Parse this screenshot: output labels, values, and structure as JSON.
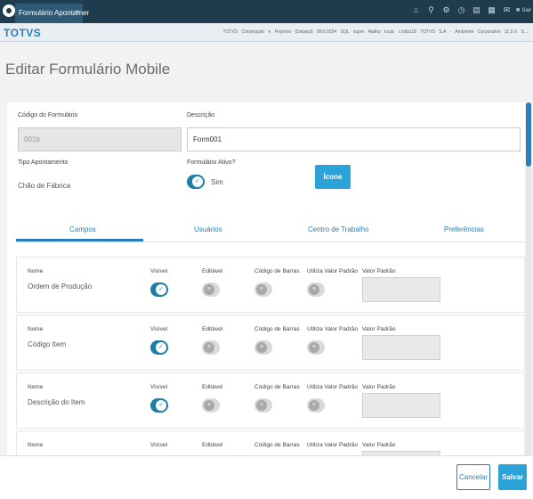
{
  "topbar": {
    "tab_label": "Formulário Apontamer",
    "tab_close": "×",
    "icons": [
      "home-icon",
      "network-icon",
      "gear-icon",
      "clock-icon",
      "print-icon",
      "grid-icon",
      "mail-icon"
    ],
    "sair": "Sair"
  },
  "header": {
    "brand": "TOTVS",
    "info": "TOTVS Construção e Projetos (Datasul) 08.6.5554  SQL  super  Atalho local: c:\\dts118  TOTVS S.A - Ambiente Corporativo 11.5.X S..."
  },
  "page": {
    "title": "Editar Formulário Mobile"
  },
  "form": {
    "codigo_label": "Código do Formulário",
    "codigo_value": "001b",
    "descricao_label": "Descrição",
    "descricao_value": "Form001",
    "tipo_label": "Tipo Apontamento",
    "tipo_value": "Chão de Fábrica",
    "ativo_label": "Formulário Ativo?",
    "ativo_value": "Sim",
    "icone_button": "Ícone"
  },
  "tabs": [
    {
      "label": "Campos",
      "active": true
    },
    {
      "label": "Usuários"
    },
    {
      "label": "Centro de Trabalho"
    },
    {
      "label": "Preferências"
    }
  ],
  "columns": {
    "nome": "Nome",
    "visivel": "Visível",
    "editavel": "Editável",
    "codigo_barras": "Código de Barras",
    "utiliza_valor_padrao": "Utiliza Valor Padrão",
    "valor_padrao": "Valor Padrão"
  },
  "rows": [
    {
      "nome": "Ordem de Produção",
      "visivel": true,
      "editavel": false,
      "codigo_barras": false,
      "utiliza": false,
      "valor_padrao": ""
    },
    {
      "nome": "Código Item",
      "visivel": true,
      "editavel": false,
      "codigo_barras": false,
      "utiliza": false,
      "valor_padrao": ""
    },
    {
      "nome": "Descrição do Item",
      "visivel": true,
      "editavel": false,
      "codigo_barras": false,
      "utiliza": false,
      "valor_padrao": ""
    },
    {
      "nome": "",
      "visivel": true,
      "editavel": false,
      "codigo_barras": false,
      "utiliza": false,
      "valor_padrao": ""
    }
  ],
  "footer": {
    "cancel": "Cancelar",
    "save": "Salvar"
  },
  "colors": {
    "accent": "#2a7fb8",
    "toggle_on": "#1e7ea5",
    "topbar": "#1f3c4f"
  }
}
